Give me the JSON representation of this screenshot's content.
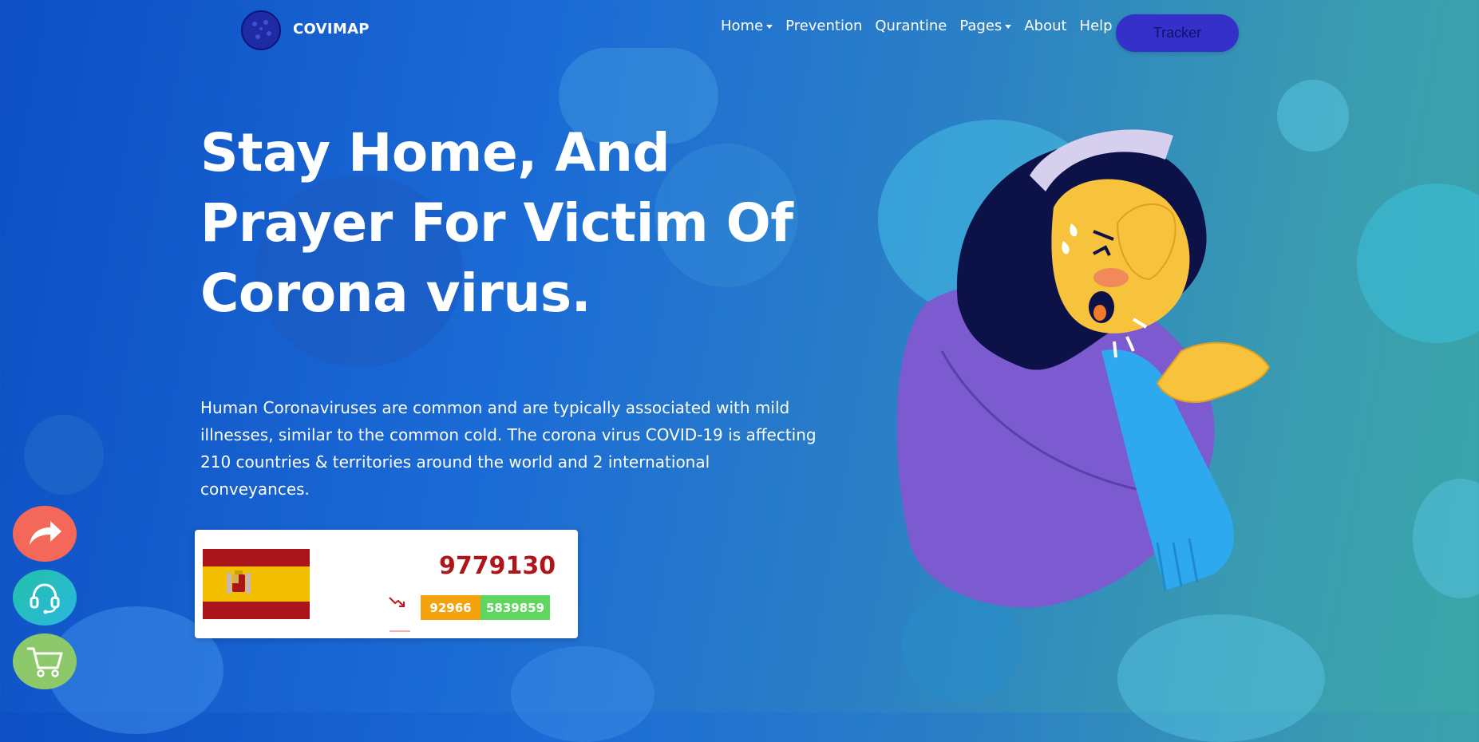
{
  "brand": {
    "name": "COVIMAP"
  },
  "nav": {
    "items": [
      {
        "label": "Home",
        "dropdown": true
      },
      {
        "label": "Prevention",
        "dropdown": false
      },
      {
        "label": "Qurantine",
        "dropdown": false
      },
      {
        "label": "Pages",
        "dropdown": true
      },
      {
        "label": "About",
        "dropdown": false
      },
      {
        "label": "Help",
        "dropdown": false
      }
    ],
    "cta_label": "Tracker"
  },
  "hero": {
    "title_line1": "Stay Home, And",
    "title_line2": "Prayer For Victim Of",
    "title_line3": "Corona virus.",
    "description": "Human Coronaviruses are common and are typically associated with mild illnesses, similar to the common cold. The corona virus COVID-19 is affecting 210 countries & territories around the world and 2 international conveyances."
  },
  "stats": {
    "country_flag": "spain-flag-icon",
    "total": "9779130",
    "deaths": "92966",
    "recovered": "5839859",
    "trend_icon": "trend-down-icon"
  },
  "floating_buttons": [
    "share-icon",
    "headset-icon",
    "cart-icon"
  ],
  "colors": {
    "accent": "#3430c9",
    "total_text": "#b0151a",
    "deaths_bg": "#f5a20f",
    "recovered_bg": "#5fd65f",
    "share_bg": "#f4685a",
    "cart_bg": "#8dc96a"
  }
}
